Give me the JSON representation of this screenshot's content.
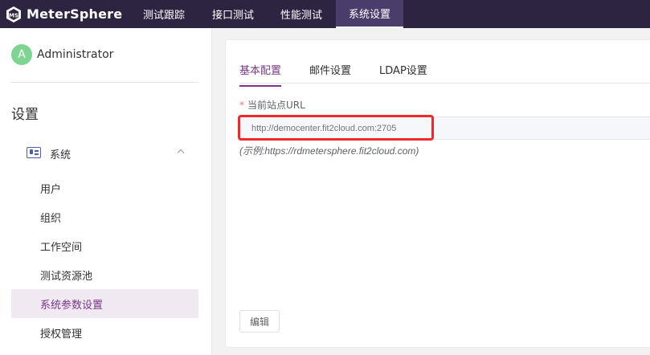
{
  "header": {
    "logo_text": "MeterSphere",
    "nav": [
      {
        "label": "测试跟踪"
      },
      {
        "label": "接口测试"
      },
      {
        "label": "性能测试"
      },
      {
        "label": "系统设置"
      }
    ]
  },
  "sidebar": {
    "avatar_initial": "A",
    "username": "Administrator",
    "title": "设置",
    "group_label": "系统",
    "items": [
      {
        "label": "用户"
      },
      {
        "label": "组织"
      },
      {
        "label": "工作空间"
      },
      {
        "label": "测试资源池"
      },
      {
        "label": "系统参数设置"
      },
      {
        "label": "授权管理"
      }
    ]
  },
  "main": {
    "tabs": [
      {
        "label": "基本配置"
      },
      {
        "label": "邮件设置"
      },
      {
        "label": "LDAP设置"
      }
    ],
    "required_mark": "*",
    "field_label": "当前站点URL",
    "url_placeholder": "http://democenter.fit2cloud.com:2705",
    "hint": "(示例:https://rdmetersphere.fit2cloud.com)",
    "edit_button": "编辑"
  },
  "colors": {
    "topbar": "#2d2441",
    "accent": "#783887",
    "active_item_bg": "#f1e9f2",
    "highlight": "#ee2a2a",
    "avatar": "#7ed491"
  },
  "icons": [
    "metersphere-logo-icon",
    "id-card-icon",
    "chevron-up-icon"
  ]
}
